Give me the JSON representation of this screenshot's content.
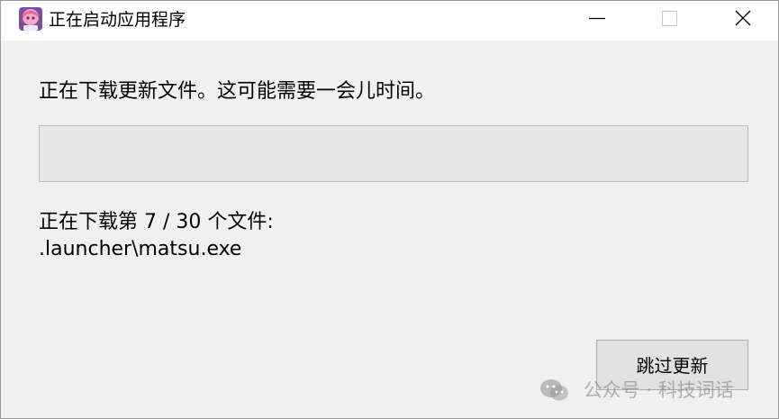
{
  "window": {
    "title": "正在启动应用程序",
    "icon": "anime-avatar-icon"
  },
  "main": {
    "message": "正在下载更新文件。这可能需要一会儿时间。",
    "progress_fraction": 0.0,
    "status_line1": "正在下载第 7 / 30 个文件:",
    "status_line2": ".launcher\\matsu.exe",
    "skip_label": "跳过更新"
  },
  "watermark": {
    "text": "公众号 · 科技词话",
    "icon": "wechat-icon"
  },
  "colors": {
    "titlebar": "#ffffff",
    "body": "#f0f0f0",
    "progress_track": "#e6e6e6",
    "button_face": "#e1e1e1"
  }
}
